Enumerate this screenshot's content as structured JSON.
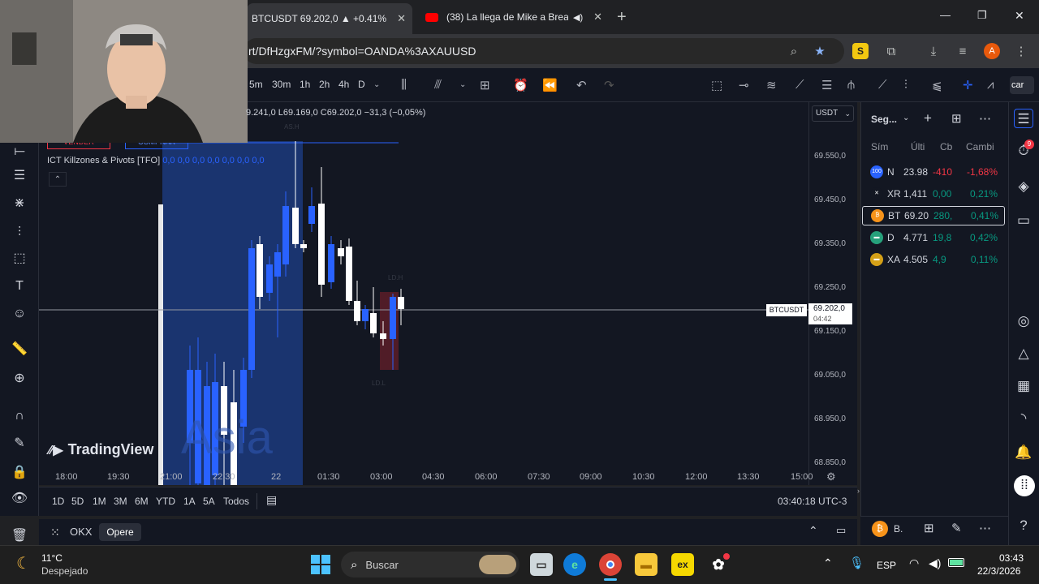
{
  "browser": {
    "tabs": [
      {
        "title": "BTCUSDT 69.202,0 ▲ +0.41% Si",
        "active": true
      },
      {
        "title": "(38) La llega de Mike a Brea",
        "active": false
      }
    ],
    "new_tab": "+",
    "url": "rt/DfHzgxFM/?symbol=OANDA%3AXAUUSD",
    "profile_initial": "A",
    "window_controls": {
      "minimize": "—",
      "restore": "❐",
      "close": "✕"
    }
  },
  "tv": {
    "timeframes": [
      "5m",
      "30m",
      "1h",
      "2h",
      "4h",
      "D"
    ],
    "ohlc": "9.241,0  L69.169,0  C69.202,0  −31,3 (−0,05%)",
    "trade": {
      "sell": "VENDER",
      "buy": "COMPRAR"
    },
    "indicator": {
      "name": "ICT Killzones & Pivots [TFO]",
      "values": "0,0 0,0 0,0 0,0 0,0 0,0 0,0"
    },
    "chart_labels": {
      "ld_h": "LD.H",
      "ld_l": "LD.L",
      "as_h": "AS.H",
      "session": "Asia"
    },
    "watermark": "TradingView",
    "currency": "USDT",
    "price_ticks": [
      "69.550,0",
      "69.450,0",
      "69.350,0",
      "69.250,0",
      "69.150,0",
      "69.050,0",
      "68.950,0",
      "68.850,0"
    ],
    "last_price": {
      "symbol": "BTCUSDT",
      "price": "69.202,0",
      "countdown": "04:42"
    },
    "time_ticks": [
      "18:00",
      "19:30",
      "21:00",
      "22:30",
      "22",
      "01:30",
      "03:00",
      "04:30",
      "06:00",
      "07:30",
      "09:00",
      "10:30",
      "12:00",
      "13:30",
      "15:00"
    ],
    "ranges": [
      "1D",
      "5D",
      "1M",
      "3M",
      "6M",
      "YTD",
      "1A",
      "5A",
      "Todos"
    ],
    "clock": "03:40:18 UTC-3",
    "broker": {
      "name": "OKX",
      "action": "Opere"
    },
    "search_right": "car"
  },
  "watchlist": {
    "title": "Seg...",
    "columns": [
      "Sím",
      "Últi",
      "Cb",
      "Cambi"
    ],
    "rows": [
      {
        "sym": "N",
        "last": "23.98",
        "chg": "-410",
        "pct": "-1,68%",
        "color": "#f23645",
        "icon_bg": "#2962ff",
        "icon": "100"
      },
      {
        "sym": "XR",
        "last": "1,411",
        "chg": "0,00",
        "pct": "0,21%",
        "color": "#089981",
        "icon_bg": "#131722",
        "icon": "✕"
      },
      {
        "sym": "BT",
        "last": "69.20",
        "chg": "280,",
        "pct": "0,41%",
        "color": "#089981",
        "icon_bg": "#f7931a",
        "icon": "₿"
      },
      {
        "sym": "D",
        "last": "4.771",
        "chg": "19,8",
        "pct": "0,42%",
        "color": "#089981",
        "icon_bg": "#26a17b",
        "icon": "▬"
      },
      {
        "sym": "XA",
        "last": "4.505",
        "chg": "4,9",
        "pct": "0,11%",
        "color": "#089981",
        "icon_bg": "#d4a017",
        "icon": "▬"
      }
    ],
    "widget_label": "B."
  },
  "taskbar": {
    "weather_temp": "11°C",
    "weather_desc": "Despejado",
    "search": "Buscar",
    "lang": "ESP",
    "time": "03:43",
    "date": "22/3/2026"
  },
  "colors": {
    "bg": "#131722",
    "up": "#ffffff",
    "down": "#2962ff",
    "asia": "#1e3f8a"
  }
}
